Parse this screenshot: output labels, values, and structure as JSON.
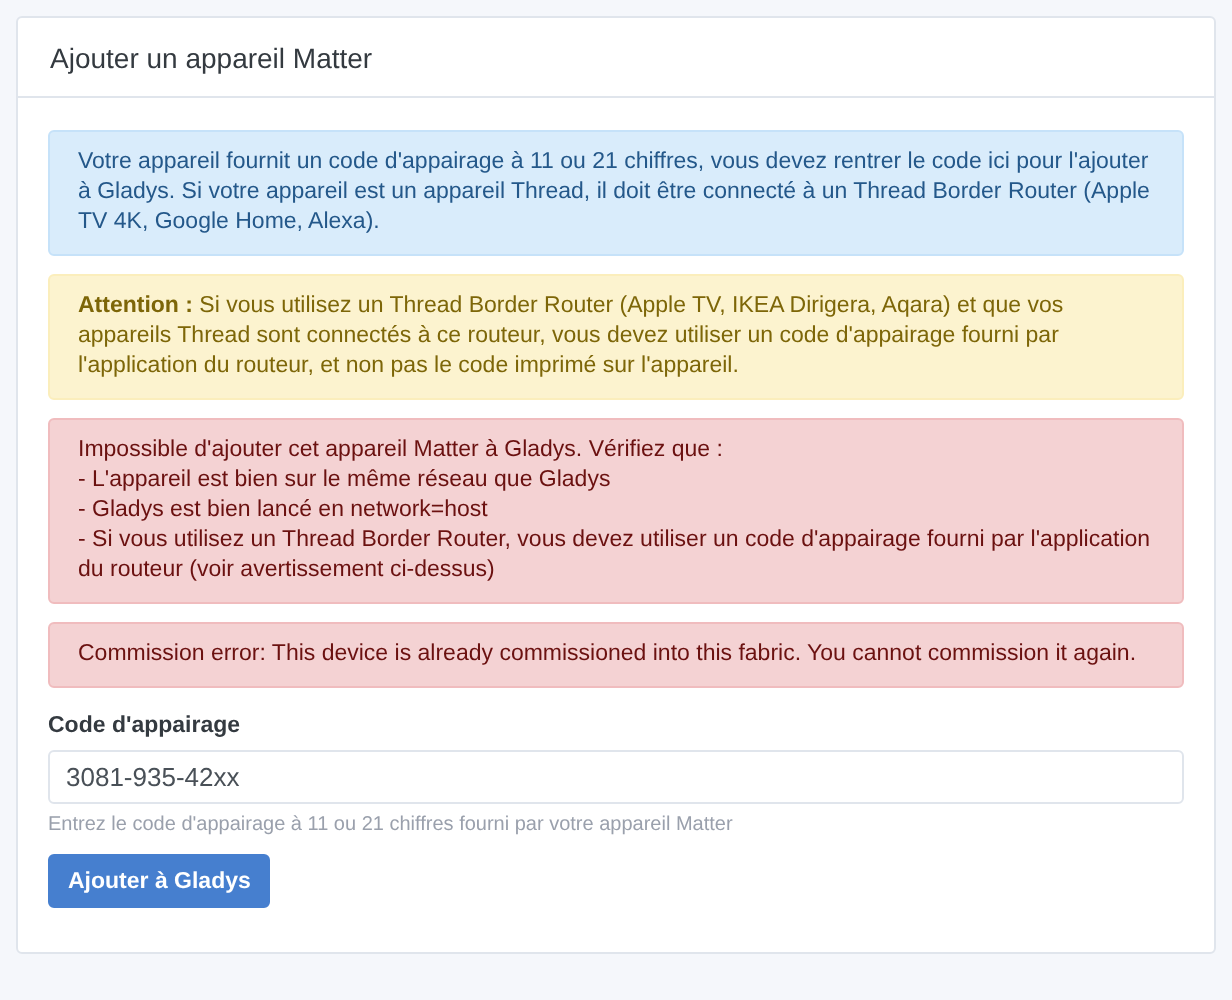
{
  "card": {
    "title": "Ajouter un appareil Matter"
  },
  "alerts": [
    {
      "kind": "info",
      "lines": [
        "Votre appareil fournit un code d'appairage à 11 ou 21 chiffres, vous devez rentrer le code ici pour l'ajouter à Gladys. Si votre appareil est un appareil Thread, il doit être connecté à un Thread Border Router (Apple TV 4K, Google Home, Alexa)."
      ]
    },
    {
      "kind": "warning",
      "lines": [
        "**Attention :** Si vous utilisez un Thread Border Router (Apple TV, IKEA Dirigera, Aqara) et que vos appareils Thread sont connectés à ce routeur, vous devez utiliser un code d'appairage fourni par l'application du routeur, et non pas le code imprimé sur l'appareil."
      ]
    },
    {
      "kind": "danger",
      "lines": [
        "Impossible d'ajouter cet appareil Matter à Gladys. Vérifiez que :",
        "- L'appareil est bien sur le même réseau que Gladys",
        "- Gladys est bien lancé en network=host",
        "- Si vous utilisez un Thread Border Router, vous devez utiliser un code d'appairage fourni par l'application du routeur (voir avertissement ci-dessus)"
      ]
    },
    {
      "kind": "danger",
      "lines": [
        "Commission error: This device is already commissioned into this fabric. You cannot commission it again."
      ]
    }
  ],
  "field": {
    "label": "Code d'appairage",
    "value": "3081-935-42xx",
    "help": "Entrez le code d'appairage à 11 ou 21 chiffres fourni par votre appareil Matter"
  },
  "button": {
    "label": "Ajouter à Gladys"
  }
}
